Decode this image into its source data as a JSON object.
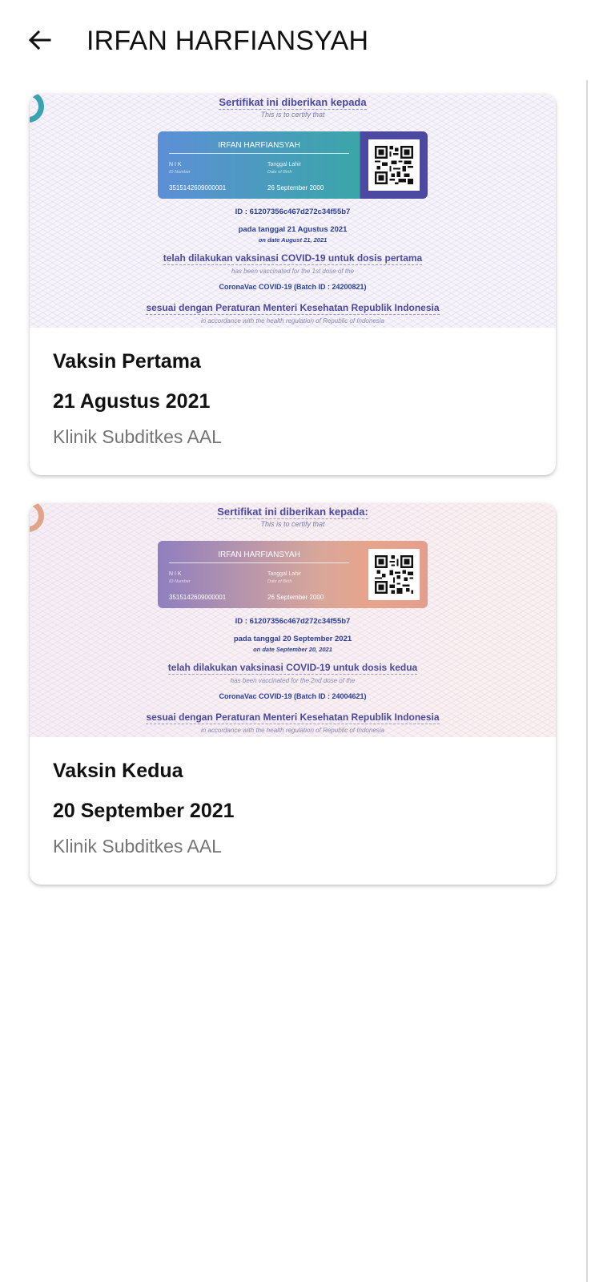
{
  "header": {
    "title": "IRFAN HARFIANSYAH"
  },
  "certificates": [
    {
      "heading": "Sertifikat ini diberikan kepada",
      "heading_en": "This is to certify that",
      "name": "IRFAN HARFIANSYAH",
      "nik_label": "N I K",
      "nik_label_en": "ID Number",
      "nik": "3515142609000001",
      "dob_label": "Tanggal Lahir",
      "dob_label_en": "Date of Birth",
      "dob": "26 September 2000",
      "cert_id": "ID : 61207356c467d272c34f55b7",
      "date_line": "pada tanggal 21 Agustus 2021",
      "date_line_en": "on date August 21, 2021",
      "vaccinated_line": "telah dilakukan vaksinasi COVID-19 untuk dosis pertama",
      "vaccinated_line_en": "has been vaccinated for the 1st dose of the",
      "batch": "CoronaVac COVID-19 (Batch ID : 24200821)",
      "regulation": "sesuai dengan Peraturan Menteri Kesehatan Republik Indonesia",
      "regulation_en": "in accordance with the health regulation of Republic of Indonesia",
      "dose_title": "Vaksin Pertama",
      "date": "21 Agustus 2021",
      "clinic": "Klinik Subditkes AAL"
    },
    {
      "heading": "Sertifikat ini diberikan kepada:",
      "heading_en": "This is to certify that",
      "name": "IRFAN HARFIANSYAH",
      "nik_label": "N I K",
      "nik_label_en": "ID Number",
      "nik": "3515142609000001",
      "dob_label": "Tanggal Lahir",
      "dob_label_en": "Date of Birth",
      "dob": "26 September 2000",
      "cert_id": "ID : 61207356c467d272c34f55b7",
      "date_line": "pada tanggal 20 September 2021",
      "date_line_en": "on date September 20, 2021",
      "vaccinated_line": "telah dilakukan vaksinasi COVID-19 untuk dosis kedua",
      "vaccinated_line_en": "has been vaccinated for the 2nd dose of the",
      "batch": "CoronaVac COVID-19 (Batch ID : 24004621)",
      "regulation": "sesuai dengan Peraturan Menteri Kesehatan Republik Indonesia",
      "regulation_en": "in accordance with the health regulation of Republic of Indonesia",
      "dose_title": "Vaksin Kedua",
      "date": "20 September 2021",
      "clinic": "Klinik Subditkes AAL"
    }
  ]
}
